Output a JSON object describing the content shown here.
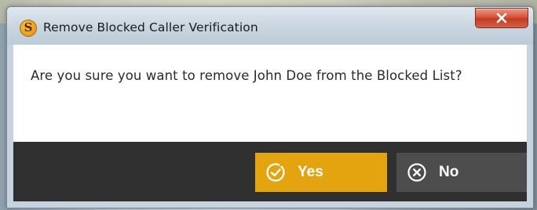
{
  "window": {
    "title": "Remove Blocked Caller Verification",
    "app_icon": "s-logo-icon",
    "close_icon": "close-x-icon"
  },
  "message": "Are you sure you want to remove John Doe from the Blocked List?",
  "buttons": {
    "yes": {
      "label": "Yes",
      "icon": "check-circle-icon",
      "color": "#e3a40f"
    },
    "no": {
      "label": "No",
      "icon": "x-circle-icon",
      "color": "#4d4d4d"
    }
  },
  "colors": {
    "footer": "#303030",
    "content": "#ffffff"
  }
}
